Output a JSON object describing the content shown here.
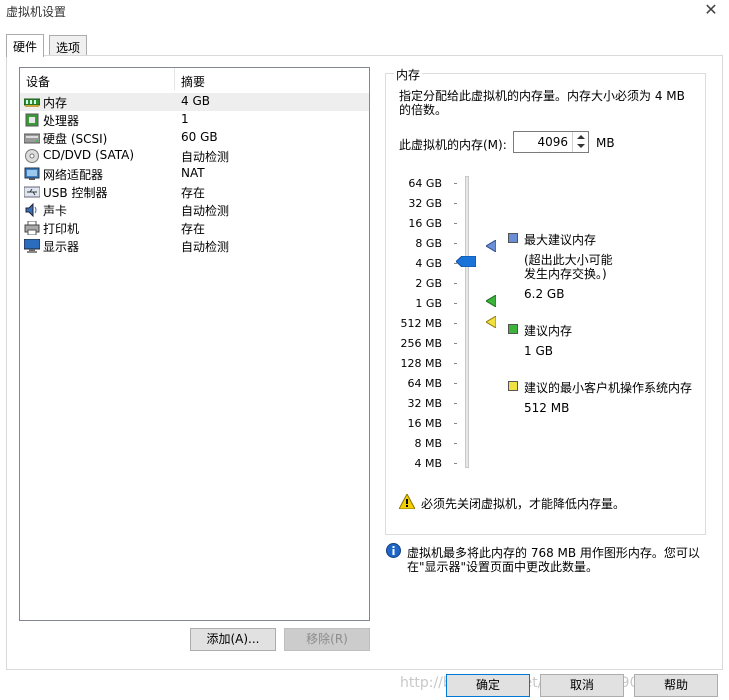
{
  "window": {
    "title": "虚拟机设置",
    "close_glyph": "✕"
  },
  "tabs": [
    {
      "label": "硬件"
    },
    {
      "label": "选项"
    }
  ],
  "device_list": {
    "col_device": "设备",
    "col_summary": "摘要",
    "rows": [
      {
        "icon": "memory-icon",
        "name": "内存",
        "summary": "4 GB"
      },
      {
        "icon": "processor-icon",
        "name": "处理器",
        "summary": "1"
      },
      {
        "icon": "harddisk-icon",
        "name": "硬盘 (SCSI)",
        "summary": "60 GB"
      },
      {
        "icon": "cd-dvd-icon",
        "name": "CD/DVD (SATA)",
        "summary": "自动检测"
      },
      {
        "icon": "network-adapter-icon",
        "name": "网络适配器",
        "summary": "NAT"
      },
      {
        "icon": "usb-icon",
        "name": "USB 控制器",
        "summary": "存在"
      },
      {
        "icon": "sound-card-icon",
        "name": "声卡",
        "summary": "自动检测"
      },
      {
        "icon": "printer-icon",
        "name": "打印机",
        "summary": "存在"
      },
      {
        "icon": "display-icon",
        "name": "显示器",
        "summary": "自动检测"
      }
    ],
    "add_button": "添加(A)...",
    "remove_button": "移除(R)"
  },
  "memory": {
    "group_title": "内存",
    "desc_line1": "指定分配给此虚拟机的内存量。内存大小必须为 4 MB",
    "desc_line2": "的倍数。",
    "field_label": "此虚拟机的内存(M):",
    "value": "4096",
    "unit": "MB",
    "scale_ticks": [
      "64 GB",
      "32 GB",
      "16 GB",
      "8 GB",
      "4 GB",
      "2 GB",
      "1 GB",
      "512 MB",
      "256 MB",
      "128 MB",
      "64 MB",
      "32 MB",
      "16 MB",
      "8 MB",
      "4 MB"
    ],
    "max_recommended": {
      "title": "最大建议内存",
      "note1": "(超出此大小可能",
      "note2": "发生内存交换。)",
      "value": "6.2 GB",
      "color": "#6b8fd6"
    },
    "recommended": {
      "title": "建议内存",
      "value": "1 GB",
      "color": "#3cb43c"
    },
    "guest_min": {
      "title": "建议的最小客户机操作系统内存",
      "value": "512 MB",
      "color": "#f0e040"
    },
    "warning": "必须先关闭虚拟机，才能降低内存量。",
    "info_line1": "虚拟机最多将此内存的 768 MB 用作图形内存。您可以",
    "info_line2": "在\"显示器\"设置页面中更改此数量。"
  },
  "footer": {
    "ok": "确定",
    "cancel": "取消",
    "help": "帮助",
    "watermark": "http://blog.csdn.net/qq_34168390"
  }
}
